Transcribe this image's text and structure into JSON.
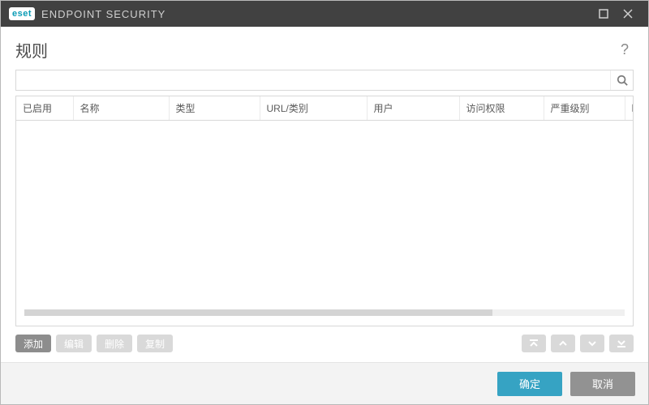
{
  "titlebar": {
    "logo_text": "eset",
    "product_name": "ENDPOINT SECURITY"
  },
  "header": {
    "title": "规则",
    "help": "?"
  },
  "search": {
    "value": "",
    "placeholder": ""
  },
  "table": {
    "columns": [
      "已启用",
      "名称",
      "类型",
      "URL/类别",
      "用户",
      "访问权限",
      "严重级别",
      "时"
    ]
  },
  "toolbar": {
    "add": "添加",
    "edit": "编辑",
    "delete": "删除",
    "copy": "复制"
  },
  "footer": {
    "ok": "确定",
    "cancel": "取消"
  }
}
